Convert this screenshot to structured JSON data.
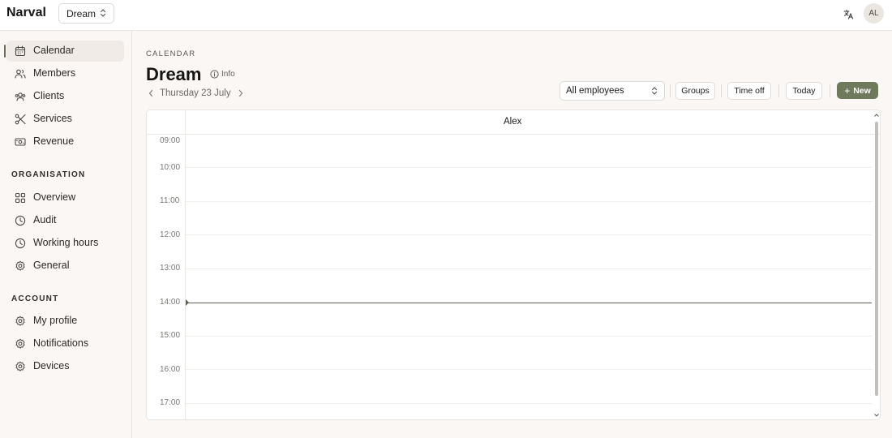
{
  "header": {
    "brand": "Narval",
    "workspace_select": "Dream",
    "avatar_initials": "AL",
    "icons": [
      "chevron-updown-icon",
      "translate-icon"
    ]
  },
  "sidebar": {
    "main_items": [
      {
        "label": "Calendar",
        "icon": "calendar-icon",
        "active": true
      },
      {
        "label": "Members",
        "icon": "users-icon"
      },
      {
        "label": "Clients",
        "icon": "clients-icon"
      },
      {
        "label": "Services",
        "icon": "scissors-icon"
      },
      {
        "label": "Revenue",
        "icon": "banknote-icon"
      }
    ],
    "organisation_heading": "ORGANISATION",
    "organisation_items": [
      {
        "label": "Overview",
        "icon": "grid-icon"
      },
      {
        "label": "Audit",
        "icon": "clock-icon"
      },
      {
        "label": "Working hours",
        "icon": "clock-icon"
      },
      {
        "label": "General",
        "icon": "settings-icon"
      }
    ],
    "account_heading": "ACCOUNT",
    "account_items": [
      {
        "label": "My profile",
        "icon": "settings-icon"
      },
      {
        "label": "Notifications",
        "icon": "settings-icon"
      },
      {
        "label": "Devices",
        "icon": "settings-icon"
      }
    ]
  },
  "main": {
    "kicker": "CALENDAR",
    "title": "Dream",
    "info_label": "Info",
    "date_label": "Thursday 23 July",
    "employee_select": "All employees",
    "groups_label": "Groups",
    "time_off_label": "Time off",
    "today_label": "Today",
    "new_label": "New"
  },
  "calendar": {
    "column_name": "Alex",
    "hours": [
      "09:00",
      "10:00",
      "11:00",
      "12:00",
      "13:00",
      "14:00",
      "15:00",
      "16:00",
      "17:00"
    ],
    "current_time": "14:00",
    "accent_color": "#6f7a5c"
  }
}
